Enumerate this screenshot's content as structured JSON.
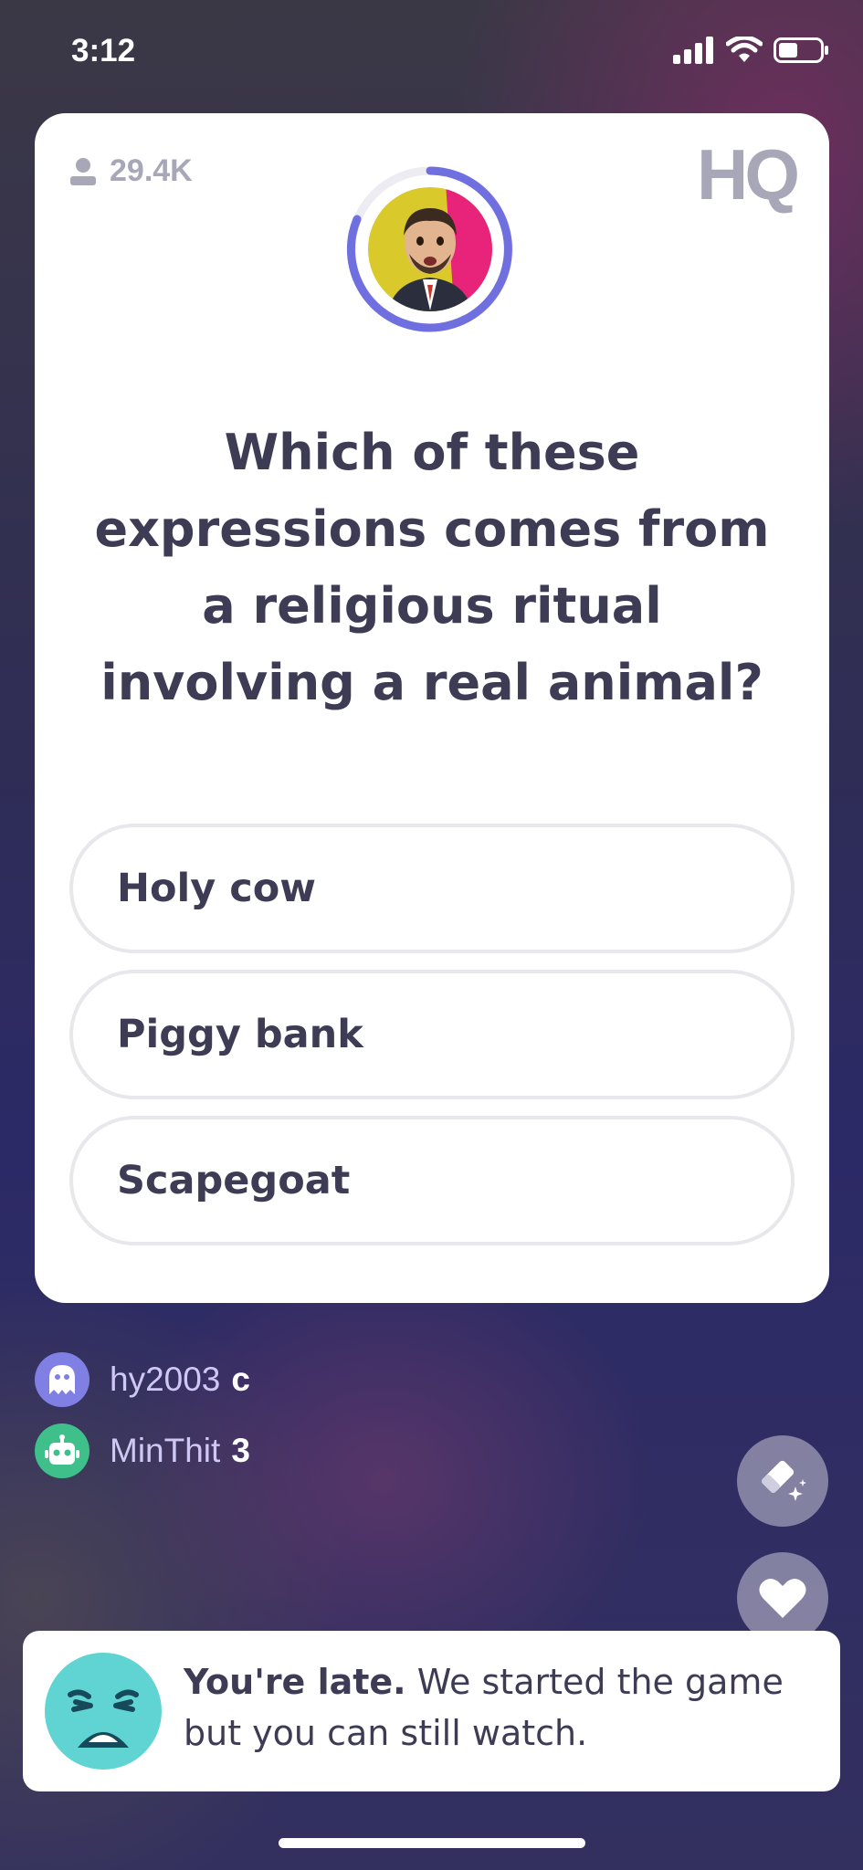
{
  "status_bar": {
    "time": "3:12"
  },
  "card": {
    "viewer_count": "29.4K",
    "logo": "HQ",
    "question": "Which of these expressions comes from a religious ritual involving a real animal?",
    "answers": [
      {
        "label": "Holy cow"
      },
      {
        "label": "Piggy bank"
      },
      {
        "label": "Scapegoat"
      }
    ],
    "timer_ring_color": "#6f6fe0",
    "host_bg_colors": [
      "#d9c92a",
      "#e8237a"
    ]
  },
  "chat": [
    {
      "user": "hy2003",
      "message": "c",
      "avatar_icon": "ghost-icon",
      "avatar_color": "#7f7fe4"
    },
    {
      "user": "MinThit",
      "message": "3",
      "avatar_icon": "robot-icon",
      "avatar_color": "#3fbf8a"
    }
  ],
  "buttons": {
    "eraser_icon": "eraser-sparkle-icon",
    "heart_icon": "heart-icon"
  },
  "banner": {
    "bold": "You're late.",
    "text": " We started the game but you can still watch.",
    "emoji_color": "#5fd4d2"
  }
}
